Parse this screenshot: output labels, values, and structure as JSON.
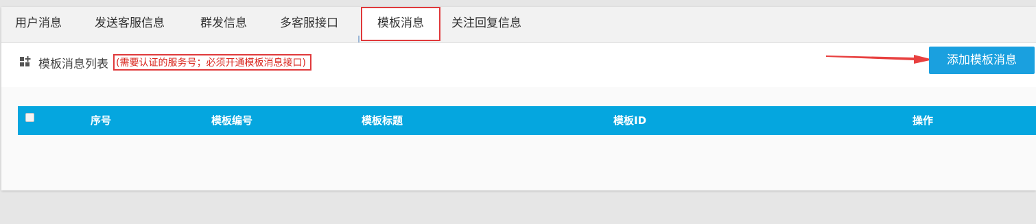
{
  "tabs": [
    {
      "label": "用户消息"
    },
    {
      "label": "发送客服信息"
    },
    {
      "label": "群发信息"
    },
    {
      "label": "多客服接口"
    },
    {
      "label": "模板消息",
      "active": true
    },
    {
      "label": "关注回复信息"
    }
  ],
  "section": {
    "icon": "grid-plus-icon",
    "title": "模板消息列表",
    "notice": "(需要认证的服务号；必须开通模板消息接口)"
  },
  "toolbar": {
    "add_label": "添加模板消息"
  },
  "table": {
    "columns": [
      "序号",
      "模板编号",
      "模板标题",
      "模板ID",
      "操作"
    ],
    "rows": []
  },
  "colors": {
    "accent": "#05a6df",
    "button": "#1aa0df",
    "highlight_red": "#e0393b"
  }
}
